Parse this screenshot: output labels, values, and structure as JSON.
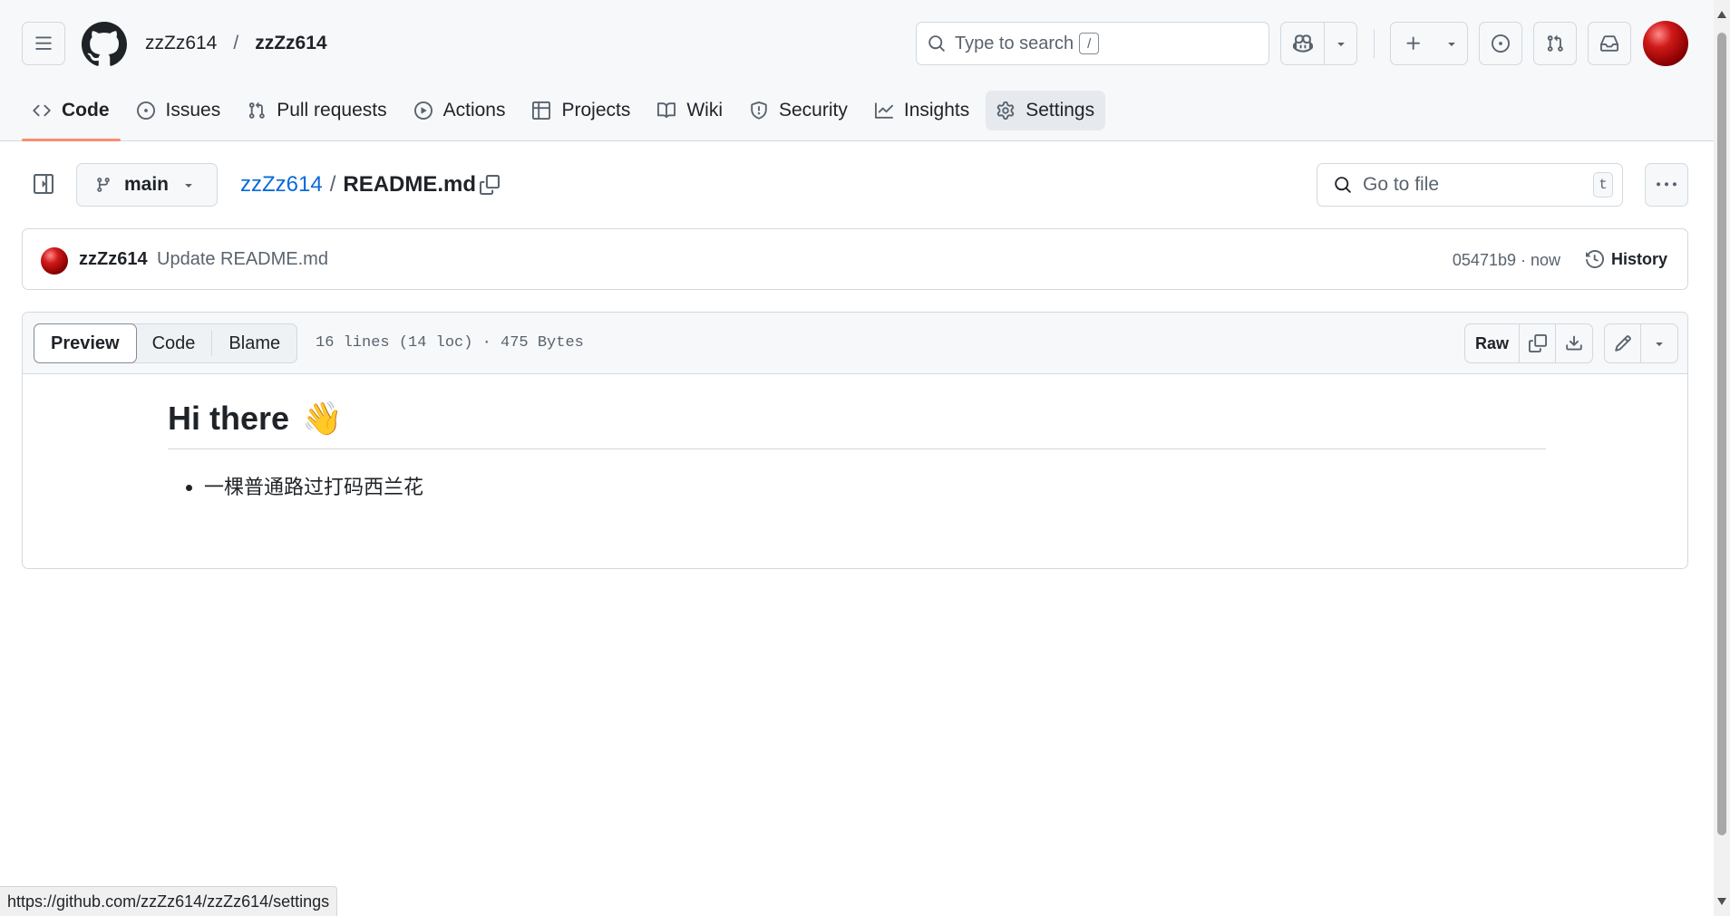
{
  "header": {
    "owner": "zzZz614",
    "separator": "/",
    "repo": "zzZz614",
    "search_placeholder": "Type to search",
    "search_shortcut": "/"
  },
  "tabs": [
    {
      "label": "Code",
      "icon": "code-icon",
      "selected": true
    },
    {
      "label": "Issues",
      "icon": "issue-opened-icon"
    },
    {
      "label": "Pull requests",
      "icon": "git-pull-request-icon"
    },
    {
      "label": "Actions",
      "icon": "play-icon"
    },
    {
      "label": "Projects",
      "icon": "table-icon"
    },
    {
      "label": "Wiki",
      "icon": "book-icon"
    },
    {
      "label": "Security",
      "icon": "shield-icon"
    },
    {
      "label": "Insights",
      "icon": "graph-icon"
    },
    {
      "label": "Settings",
      "icon": "gear-icon",
      "hover": true
    }
  ],
  "file_header": {
    "branch": "main",
    "breadcrumb_repo": "zzZz614",
    "breadcrumb_sep": "/",
    "filename": "README.md",
    "goto_placeholder": "Go to file",
    "goto_shortcut": "t"
  },
  "commit": {
    "author": "zzZz614",
    "message": "Update README.md",
    "meta": "05471b9 · now",
    "history_label": "History"
  },
  "file_view": {
    "modes": [
      "Preview",
      "Code",
      "Blame"
    ],
    "active_mode": "Preview",
    "info": "16 lines (14 loc) · 475 Bytes",
    "raw_label": "Raw"
  },
  "readme": {
    "heading": "Hi there",
    "heading_emoji": "👋",
    "items": [
      "一棵普通路过打码西兰花"
    ]
  },
  "status_url": "https://github.com/zzZz614/zzZz614/settings",
  "colors": {
    "accent": "#0969da",
    "tab_underline": "#fd8c73",
    "border": "#d1d9e0",
    "muted": "#59636e"
  }
}
